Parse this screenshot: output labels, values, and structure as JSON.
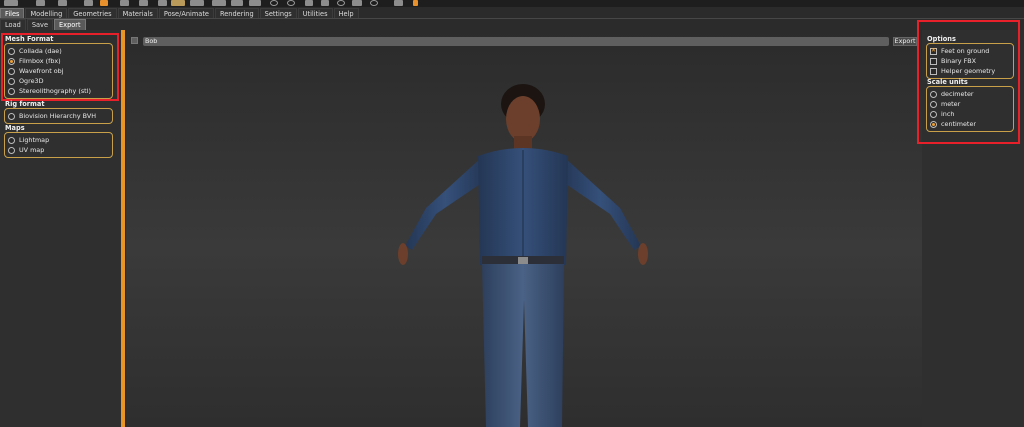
{
  "main_tabs": [
    "Files",
    "Modelling",
    "Geometries",
    "Materials",
    "Pose/Animate",
    "Rendering",
    "Settings",
    "Utilities",
    "Help"
  ],
  "active_main_tab": "Files",
  "sub_tabs": [
    "Load",
    "Save",
    "Export"
  ],
  "active_sub_tab": "Export",
  "left_panel": {
    "mesh_format": {
      "title": "Mesh Format",
      "options": [
        "Collada (dae)",
        "Filmbox (fbx)",
        "Wavefront obj",
        "Ogre3D",
        "Stereolithography (stl)"
      ],
      "selected": "Filmbox (fbx)"
    },
    "rig_format": {
      "title": "Rig format",
      "options": [
        "Biovision Hierarchy BVH"
      ]
    },
    "maps": {
      "title": "Maps",
      "options": [
        "Lightmap",
        "UV map"
      ]
    }
  },
  "viewport": {
    "filename_value": "Bob",
    "export_label": "Export"
  },
  "right_panel": {
    "options": {
      "title": "Options",
      "items": [
        {
          "label": "Feet on ground",
          "checked": true
        },
        {
          "label": "Binary FBX",
          "checked": false
        },
        {
          "label": "Helper geometry",
          "checked": false
        }
      ]
    },
    "scale_units": {
      "title": "Scale units",
      "options": [
        "decimeter",
        "meter",
        "inch",
        "centimeter"
      ],
      "selected": "centimeter"
    }
  },
  "colors": {
    "accent_orange": "#e89526",
    "highlight_red": "#e8202a",
    "skin": "#6b3f2b",
    "shirt": "#2f4569",
    "jeans": "#3d5170"
  },
  "icons": [
    "toolbar-icons",
    "figure-model"
  ]
}
